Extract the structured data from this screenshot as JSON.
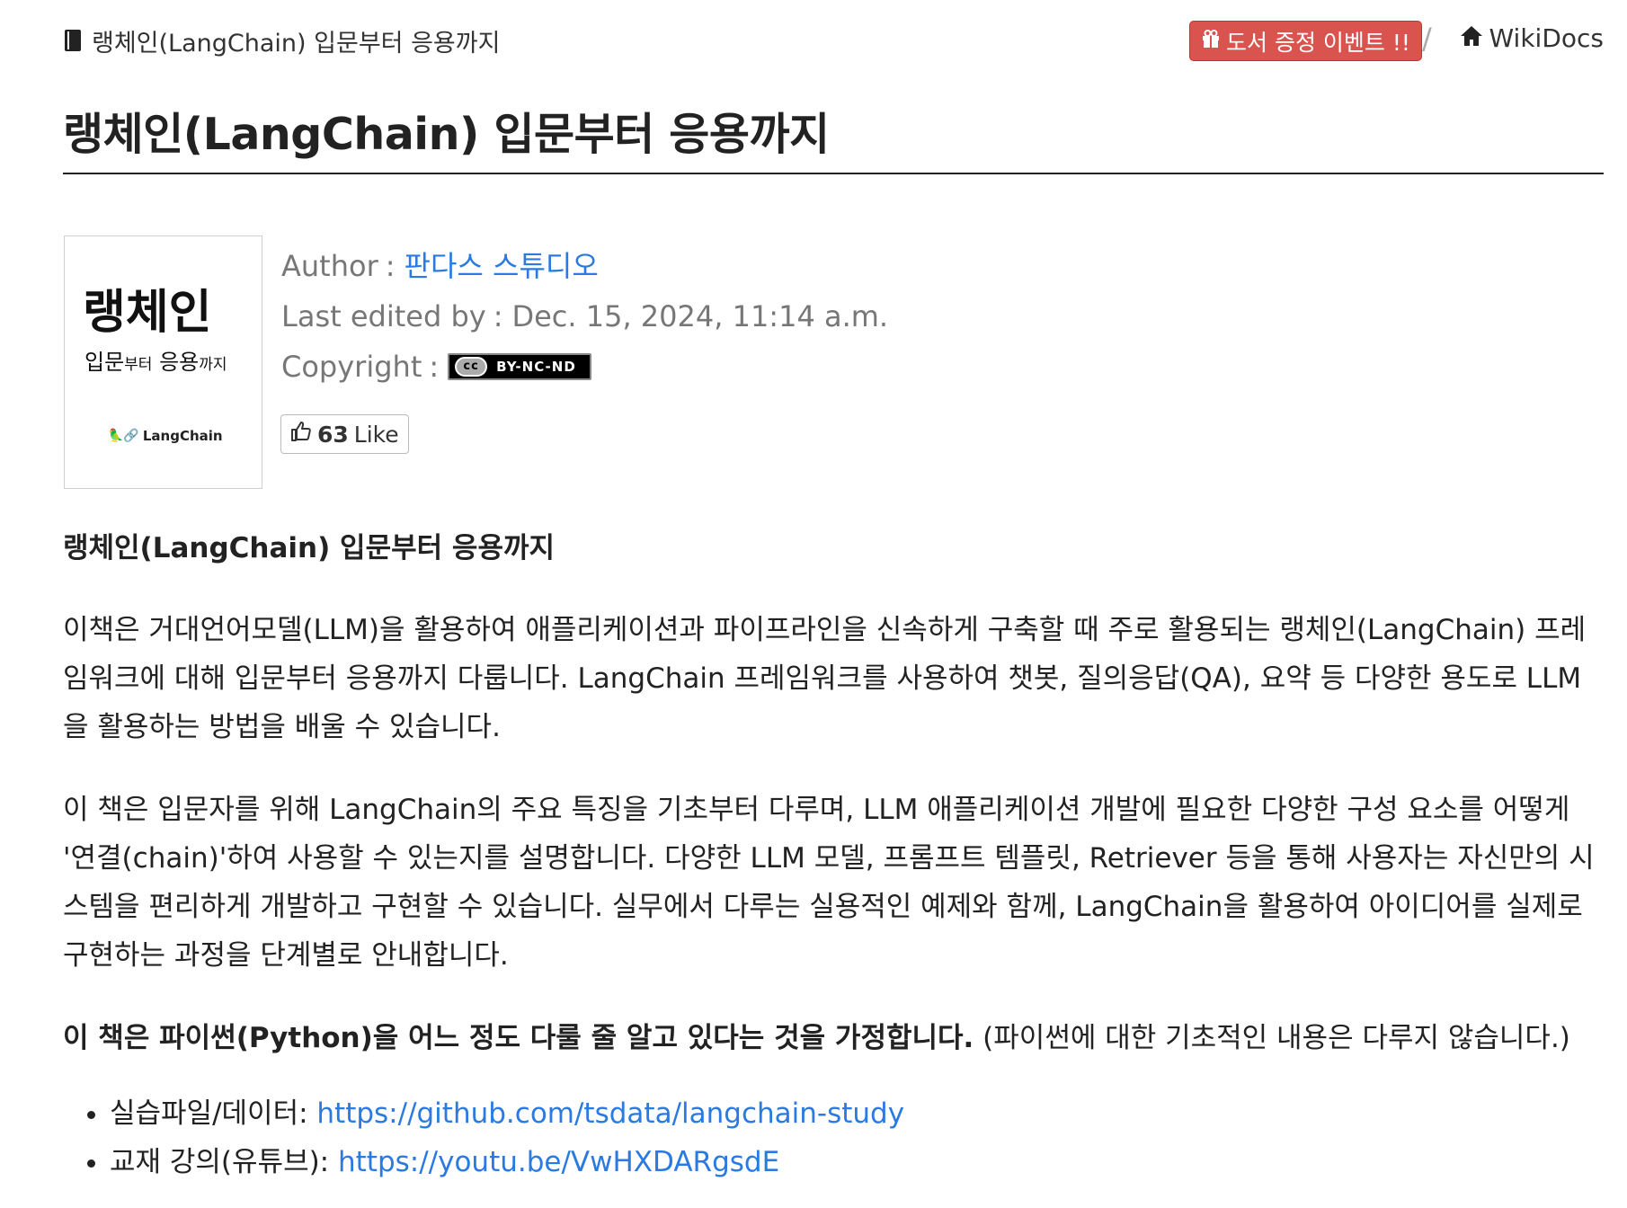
{
  "breadcrumb": {
    "book_title": "랭체인(LangChain) 입문부터 응용까지",
    "event_button": "도서 증정 이벤트 !!",
    "separator": "/",
    "site_name": "WikiDocs"
  },
  "page": {
    "title": "랭체인(LangChain) 입문부터 응용까지"
  },
  "cover": {
    "title": "랭체인",
    "subtitle_parts": [
      "입문",
      "부터",
      " 응용",
      "까지"
    ],
    "logo_text": "LangChain",
    "logo_emoji": "🦜🔗"
  },
  "meta": {
    "author_label": "Author",
    "author_name": "판다스 스튜디오",
    "edited_label": "Last edited by",
    "edited_value": "Dec. 15, 2024, 11:14 a.m.",
    "copyright_label": "Copyright",
    "license_cc": "cc",
    "license_text": "BY-NC-ND",
    "colon": ":"
  },
  "like": {
    "count": "63",
    "label": "Like"
  },
  "body": {
    "heading": "랭체인(LangChain) 입문부터 응용까지",
    "para1": "이책은 거대언어모델(LLM)을 활용하여 애플리케이션과 파이프라인을 신속하게 구축할 때 주로 활용되는 랭체인(LangChain) 프레임워크에 대해 입문부터 응용까지 다룹니다. LangChain 프레임워크를 사용하여 챗봇, 질의응답(QA), 요약 등 다양한 용도로 LLM을 활용하는 방법을 배울 수 있습니다.",
    "para2": "이 책은 입문자를 위해 LangChain의 주요 특징을 기초부터 다루며, LLM 애플리케이션 개발에 필요한 다양한 구성 요소를 어떻게 '연결(chain)'하여 사용할 수 있는지를 설명합니다. 다양한 LLM 모델, 프롬프트 템플릿, Retriever 등을 통해 사용자는 자신만의 시스템을 편리하게 개발하고 구현할 수 있습니다. 실무에서 다루는 실용적인 예제와 함께, LangChain을 활용하여 아이디어를 실제로 구현하는 과정을 단계별로 안내합니다.",
    "para3_bold": "이 책은 파이썬(Python)을 어느 정도 다룰 줄 알고 있다는 것을 가정합니다.",
    "para3_rest": " (파이썬에 대한 기초적인 내용은 다루지 않습니다.)",
    "links": [
      {
        "label": "실습파일/데이터: ",
        "url": "https://github.com/tsdata/langchain-study"
      },
      {
        "label": "교재 강의(유튜브): ",
        "url": "https://youtu.be/VwHXDARgsdE"
      }
    ]
  },
  "colors": {
    "link": "#2a7ae2",
    "event_button": "#d9534f"
  }
}
